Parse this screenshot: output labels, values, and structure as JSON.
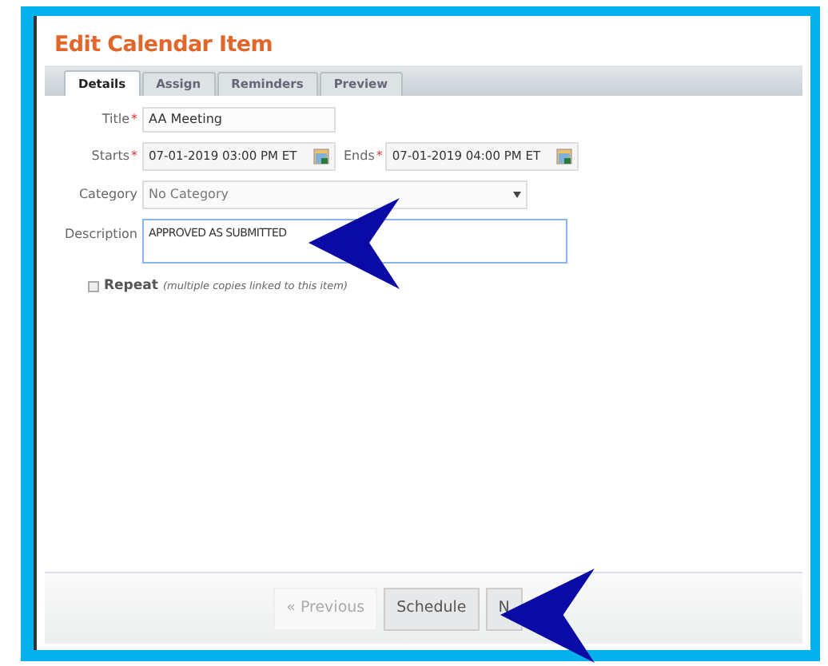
{
  "dialog": {
    "title": "Edit Calendar Item"
  },
  "tabs": [
    {
      "label": "Details",
      "selected": true
    },
    {
      "label": "Assign",
      "selected": false
    },
    {
      "label": "Reminders",
      "selected": false
    },
    {
      "label": "Preview",
      "selected": false
    }
  ],
  "form": {
    "title": {
      "label": "Title",
      "required_mark": "*",
      "value": "AA Meeting"
    },
    "starts": {
      "label": "Starts",
      "required_mark": "*",
      "value": "07-01-2019 03:00 PM ET"
    },
    "ends": {
      "label": "Ends",
      "required_mark": "*",
      "value": "07-01-2019 04:00 PM ET"
    },
    "category": {
      "label": "Category",
      "value": "No Category"
    },
    "description": {
      "label": "Description",
      "value": "APPROVED AS SUBMITTED"
    },
    "repeat": {
      "label": "Repeat",
      "note": "(multiple copies linked to this item)",
      "checked": false
    }
  },
  "buttons": [
    {
      "label": "« Previous",
      "disabled": true
    },
    {
      "label": "Schedule",
      "disabled": false
    },
    {
      "label": "N",
      "disabled": false
    }
  ]
}
